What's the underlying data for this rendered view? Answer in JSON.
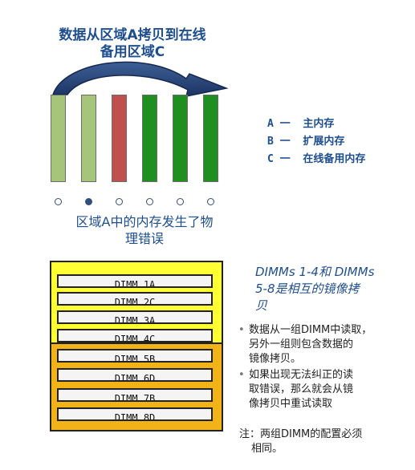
{
  "top_title": [
    "数据从区域A拷贝到在线",
    "备用区域C"
  ],
  "legend": [
    {
      "key": "A",
      "dash": "一",
      "label": "主内存"
    },
    {
      "key": "B",
      "dash": "一",
      "label": "扩展内存"
    },
    {
      "key": "C",
      "dash": "一",
      "label": "在线备用内存"
    }
  ],
  "bars": [
    {
      "type": "light",
      "color": "#a6c47a"
    },
    {
      "type": "light",
      "color": "#a6c47a"
    },
    {
      "type": "red",
      "color": "#c0504d"
    },
    {
      "type": "green",
      "color": "#1f8f1f"
    },
    {
      "type": "green",
      "color": "#1f8f1f"
    },
    {
      "type": "green",
      "color": "#1f8f1f"
    }
  ],
  "error_caption": [
    "区域A中的内存发生了物",
    "理错误"
  ],
  "dimm_group1": [
    "DIMM 1A",
    "DIMM 2C",
    "DIMM 3A",
    "DIMM 4C"
  ],
  "dimm_group2": [
    "DIMM 5B",
    "DIMM 6D",
    "DIMM 7B",
    "DIMM 8D"
  ],
  "mirror_title": [
    "DIMMs 1-4和 DIMMs",
    "5-8是相互的镜像拷",
    "贝"
  ],
  "bullets": [
    [
      "数据从一组DIMM中读取，",
      "另外一组则包含数据的",
      "镜像拷贝。"
    ],
    [
      "如果出现无法纠正的读",
      "取错误，那么就会从镜",
      "像拷贝中重试读取"
    ]
  ],
  "note": [
    "注：两组DIMM的配置必须",
    "相同。"
  ],
  "colors": {
    "accent_blue": "#1f4e8c",
    "group1_bg": "#ffff33",
    "group2_bg": "#f2b318"
  }
}
